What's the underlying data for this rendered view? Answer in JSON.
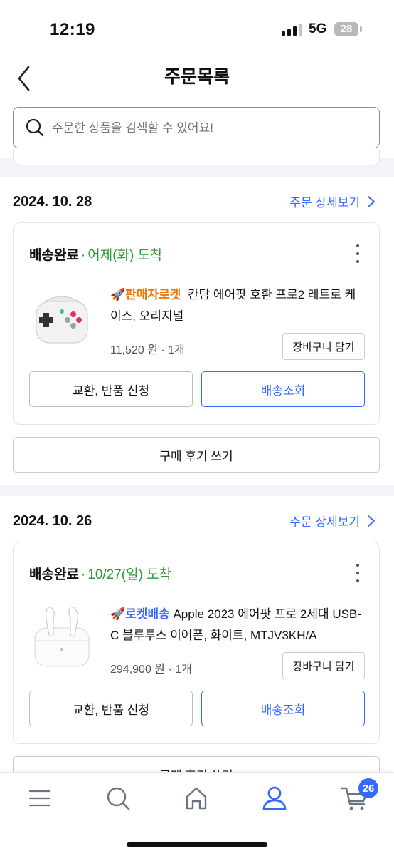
{
  "status_bar": {
    "time": "12:19",
    "network": "5G",
    "battery": "28"
  },
  "header": {
    "title": "주문목록"
  },
  "search": {
    "placeholder": "주문한 상품을 검색할 수 있어요!"
  },
  "orders": [
    {
      "date": "2024. 10. 28",
      "detail_link": "주문 상세보기",
      "status": "배송완료",
      "eta": "어제(화) 도착",
      "badge": "판매자로켓",
      "badge_type": "seller",
      "product_name": "칸탐 에어팟 호환 프로2 레트로 케이스, 오리지널",
      "price": "11,520 원",
      "quantity": "1개",
      "cart_label": "장바구니 담기",
      "exchange_label": "교환, 반품 신청",
      "tracking_label": "배송조회",
      "review_label": "구매 후기 쓰기"
    },
    {
      "date": "2024. 10. 26",
      "detail_link": "주문 상세보기",
      "status": "배송완료",
      "eta": "10/27(일) 도착",
      "badge": "로켓배송",
      "badge_type": "rocket",
      "product_name": "Apple 2023 에어팟 프로 2세대 USB-C 블루투스 이어폰, 화이트, MTJV3KH/A",
      "price": "294,900 원",
      "quantity": "1개",
      "cart_label": "장바구니 담기",
      "exchange_label": "교환, 반품 신청",
      "tracking_label": "배송조회",
      "review_label": "구매 후기 쓰기"
    }
  ],
  "bottom_nav": {
    "items": [
      "menu-icon",
      "search-icon",
      "home-icon",
      "profile-icon",
      "cart-icon"
    ],
    "cart_count": "26"
  },
  "colors": {
    "accent": "#346aff",
    "delivered_green": "#2d9b33",
    "seller_orange": "#f0750b"
  }
}
